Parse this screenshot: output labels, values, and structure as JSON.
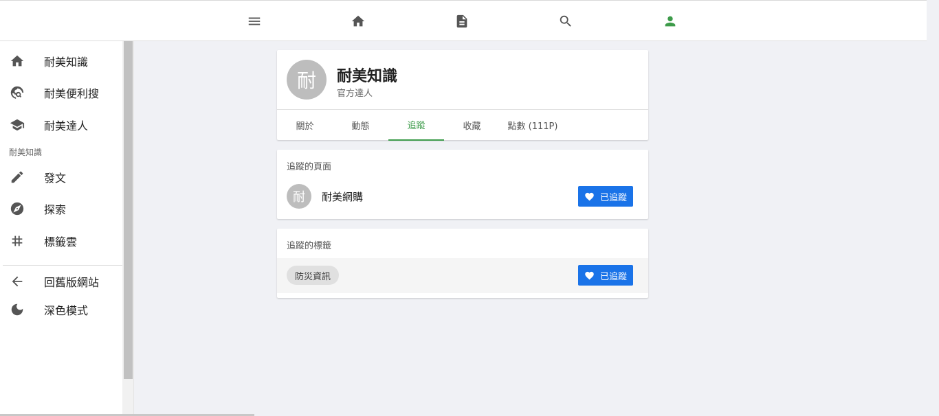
{
  "topbar": {
    "items": [
      {
        "name": "menu",
        "icon": "menu-icon"
      },
      {
        "name": "home",
        "icon": "home-icon"
      },
      {
        "name": "posts",
        "icon": "article-icon"
      },
      {
        "name": "search",
        "icon": "search-icon"
      },
      {
        "name": "profile",
        "icon": "person-icon",
        "color": "#3d9b4a"
      }
    ]
  },
  "sidebar": {
    "items": [
      {
        "label": "耐美知識",
        "icon": "home-icon"
      },
      {
        "label": "耐美便利搜",
        "icon": "travel-explore-icon"
      },
      {
        "label": "耐美達人",
        "icon": "school-icon"
      }
    ],
    "section_title": "耐美知識",
    "section_items": [
      {
        "label": "發文",
        "icon": "pencil-icon"
      },
      {
        "label": "探索",
        "icon": "compass-icon"
      },
      {
        "label": "標籤雲",
        "icon": "hashtag-icon"
      }
    ],
    "footer_items": [
      {
        "label": "回舊版網站",
        "icon": "arrow-left-icon"
      },
      {
        "label": "深色模式",
        "icon": "moon-icon"
      }
    ]
  },
  "profile": {
    "avatar_char": "耐",
    "name": "耐美知識",
    "role": "官方達人",
    "tabs": [
      {
        "label": "關於"
      },
      {
        "label": "動態"
      },
      {
        "label": "追蹤"
      },
      {
        "label": "收藏"
      },
      {
        "label": "點數 (111P)"
      }
    ],
    "active_tab": "追蹤"
  },
  "followed_pages": {
    "title": "追蹤的頁面",
    "items": [
      {
        "avatar_char": "耐",
        "name": "耐美網購",
        "button_label": "已追蹤"
      }
    ]
  },
  "followed_tags": {
    "title": "追蹤的標籤",
    "items": [
      {
        "tag": "防災資訊",
        "button_label": "已追蹤"
      }
    ]
  },
  "colors": {
    "accent_green": "#3d9b4a",
    "button_blue": "#1a73e8"
  }
}
